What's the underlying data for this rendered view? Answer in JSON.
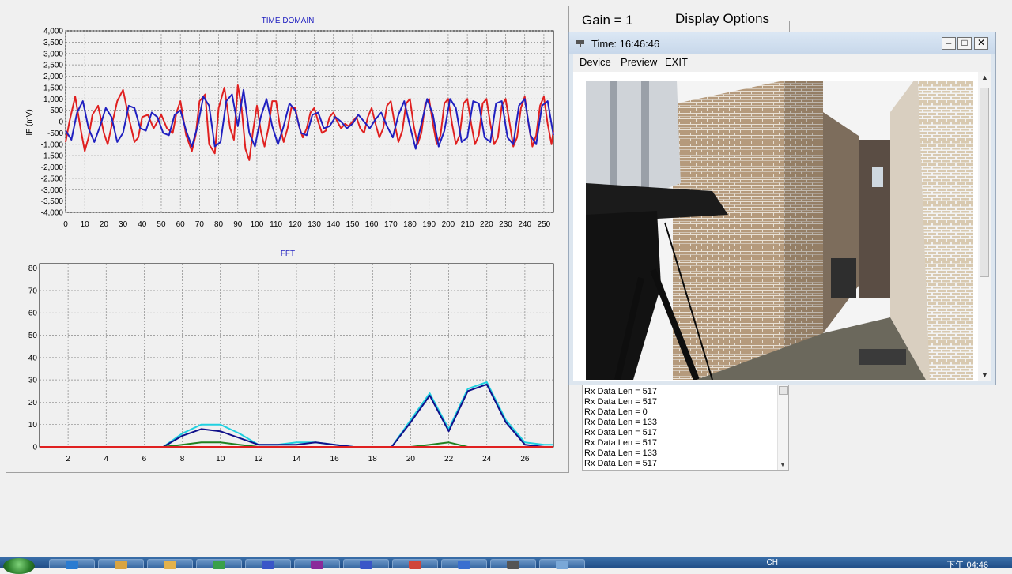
{
  "time_chart": {
    "title": "TIME DOMAIN",
    "ylabel": "IF (mV)",
    "y_ticks": [
      "4,000",
      "3,500",
      "3,000",
      "2,500",
      "2,000",
      "1,500",
      "1,000",
      "500",
      "0",
      "-500",
      "-1,000",
      "-1,500",
      "-2,000",
      "-2,500",
      "-3,000",
      "-3,500",
      "-4,000"
    ],
    "x_ticks": [
      "0",
      "10",
      "20",
      "30",
      "40",
      "50",
      "60",
      "70",
      "80",
      "90",
      "100",
      "110",
      "120",
      "130",
      "140",
      "150",
      "160",
      "170",
      "180",
      "190",
      "200",
      "210",
      "220",
      "230",
      "240",
      "250"
    ]
  },
  "fft_chart": {
    "title": "FFT",
    "y_ticks": [
      "80",
      "70",
      "60",
      "50",
      "40",
      "30",
      "20",
      "10",
      "0"
    ],
    "x_ticks": [
      "2",
      "4",
      "6",
      "8",
      "10",
      "12",
      "14",
      "16",
      "18",
      "20",
      "22",
      "24",
      "26"
    ]
  },
  "chart_data": [
    {
      "type": "line",
      "title": "TIME DOMAIN",
      "xlabel": "",
      "ylabel": "IF (mV)",
      "xlim": [
        0,
        255
      ],
      "ylim": [
        -4000,
        4000
      ],
      "grid": true,
      "series": [
        {
          "color": "#e02020",
          "x": [
            0,
            2,
            5,
            8,
            10,
            12,
            14,
            17,
            20,
            22,
            24,
            27,
            30,
            33,
            36,
            38,
            40,
            43,
            46,
            50,
            53,
            56,
            58,
            60,
            63,
            66,
            68,
            70,
            73,
            75,
            78,
            80,
            83,
            86,
            88,
            90,
            92,
            94,
            96,
            98,
            100,
            102,
            104,
            106,
            108,
            110,
            112,
            114,
            116,
            118,
            120,
            122,
            124,
            126,
            128,
            130,
            132,
            134,
            136,
            138,
            140,
            142,
            144,
            146,
            148,
            150,
            152,
            154,
            156,
            158,
            160,
            162,
            164,
            166,
            168,
            170,
            172,
            174,
            176,
            178,
            180,
            182,
            184,
            186,
            188,
            190,
            192,
            194,
            196,
            198,
            200,
            202,
            204,
            206,
            208,
            210,
            212,
            214,
            216,
            218,
            220,
            222,
            224,
            226,
            228,
            230,
            232,
            234,
            236,
            238,
            240,
            242,
            244,
            246,
            248,
            250,
            252,
            254,
            255
          ],
          "y": [
            -900,
            0,
            1100,
            -400,
            -1300,
            -700,
            300,
            700,
            -500,
            -1000,
            -200,
            900,
            1400,
            200,
            -900,
            -700,
            200,
            300,
            -300,
            300,
            -300,
            -500,
            400,
            900,
            -600,
            -1300,
            -600,
            900,
            1200,
            -1000,
            -1400,
            600,
            1500,
            -300,
            -800,
            1600,
            600,
            -1200,
            -1700,
            -400,
            700,
            -400,
            -1100,
            -300,
            900,
            900,
            -200,
            -900,
            -300,
            600,
            600,
            -200,
            -700,
            -300,
            400,
            600,
            0,
            -500,
            -400,
            200,
            400,
            0,
            -300,
            -100,
            -200,
            0,
            200,
            -300,
            -500,
            200,
            600,
            -100,
            -700,
            -300,
            700,
            900,
            -100,
            -900,
            -400,
            800,
            1000,
            -200,
            -1000,
            -500,
            800,
            1000,
            -100,
            -1000,
            -600,
            800,
            1000,
            -100,
            -1000,
            -600,
            800,
            1000,
            -100,
            -1000,
            -600,
            800,
            1000,
            -100,
            -1000,
            -700,
            700,
            1000,
            0,
            -1100,
            -700,
            600,
            1100,
            -100,
            -1100,
            -600,
            700,
            1100,
            -100,
            -1000,
            -400
          ]
        },
        {
          "color": "#2020c0",
          "x": [
            0,
            3,
            6,
            9,
            12,
            15,
            18,
            21,
            24,
            27,
            30,
            33,
            36,
            39,
            42,
            45,
            48,
            51,
            54,
            57,
            60,
            63,
            66,
            69,
            72,
            75,
            78,
            81,
            84,
            87,
            90,
            93,
            96,
            99,
            102,
            105,
            108,
            111,
            114,
            117,
            120,
            123,
            126,
            129,
            132,
            135,
            138,
            141,
            144,
            147,
            150,
            153,
            156,
            159,
            162,
            165,
            168,
            171,
            174,
            177,
            180,
            183,
            186,
            189,
            192,
            195,
            198,
            201,
            204,
            207,
            210,
            213,
            216,
            219,
            222,
            225,
            228,
            231,
            234,
            237,
            240,
            243,
            246,
            249,
            252,
            255
          ],
          "y": [
            -400,
            -800,
            400,
            900,
            -300,
            -900,
            -200,
            600,
            200,
            -900,
            -500,
            700,
            600,
            -300,
            -400,
            400,
            200,
            -500,
            -600,
            300,
            500,
            -400,
            -1100,
            -200,
            1100,
            700,
            -1100,
            -900,
            900,
            1200,
            -200,
            1400,
            -500,
            -1100,
            200,
            1000,
            -200,
            -1000,
            -200,
            800,
            500,
            -500,
            -600,
            300,
            400,
            -300,
            -200,
            200,
            0,
            -300,
            -100,
            300,
            0,
            -300,
            100,
            400,
            -200,
            -700,
            300,
            900,
            -200,
            -1200,
            -100,
            1000,
            300,
            -1100,
            -400,
            1000,
            600,
            -900,
            -700,
            900,
            800,
            -700,
            -900,
            800,
            900,
            -700,
            -1000,
            700,
            1000,
            -600,
            -1000,
            700,
            900,
            -600
          ]
        }
      ]
    },
    {
      "type": "line",
      "title": "FFT",
      "xlabel": "",
      "ylabel": "",
      "xlim": [
        0.5,
        27.5
      ],
      "ylim": [
        0,
        82
      ],
      "grid": true,
      "series": [
        {
          "color": "#20d0e0",
          "x": [
            0.5,
            7,
            8,
            9,
            10,
            11,
            12,
            13,
            14,
            15,
            16,
            17,
            19,
            20,
            21,
            22,
            23,
            24,
            25,
            26,
            27,
            27.5
          ],
          "y": [
            0,
            0,
            6,
            10,
            10,
            6,
            1,
            1,
            2,
            2,
            1,
            0,
            0,
            12,
            24,
            8,
            26,
            29,
            12,
            2,
            1,
            1
          ]
        },
        {
          "color": "#10108a",
          "x": [
            0.5,
            7,
            8,
            9,
            10,
            11,
            12,
            13,
            14,
            15,
            16,
            17,
            19,
            20,
            21,
            22,
            23,
            24,
            25,
            26,
            27,
            27.5
          ],
          "y": [
            0,
            0,
            5,
            8,
            7,
            4,
            1,
            1,
            1,
            2,
            1,
            0,
            0,
            11,
            23,
            7,
            25,
            28,
            11,
            1,
            0,
            0
          ]
        },
        {
          "color": "#208020",
          "x": [
            0.5,
            7,
            8,
            9,
            10,
            11,
            12,
            13,
            14,
            15,
            16,
            17,
            19,
            20,
            21,
            22,
            23,
            24,
            25,
            26,
            27,
            27.5
          ],
          "y": [
            0,
            0,
            1,
            2,
            2,
            1,
            0,
            0,
            0,
            0,
            0,
            0,
            0,
            0,
            1,
            2,
            0,
            0,
            0,
            0,
            0,
            0
          ]
        },
        {
          "color": "#e02020",
          "x": [
            0.5,
            27.5
          ],
          "y": [
            0,
            0
          ]
        }
      ]
    }
  ],
  "controls": {
    "gain_label": "Gain = 1",
    "display_options_label": "Display Options"
  },
  "log": {
    "lines": [
      "Rx Data Len = 517",
      "Rx Data Len = 517",
      "Rx Data Len = 0",
      "Rx Data Len = 133",
      "Rx Data Len = 517",
      "Rx Data Len = 517",
      "Rx Data Len = 133",
      "Rx Data Len = 517"
    ]
  },
  "preview_window": {
    "title": "Time: 16:46:46",
    "menu": [
      "Device",
      "Preview",
      "EXIT"
    ],
    "minimize": "–",
    "maximize": "□",
    "close": "✕"
  },
  "taskbar": {
    "clock": "下午 04:46",
    "ime": "CH",
    "apps": [
      "explorer",
      "folder",
      "excel",
      "cascade",
      "help",
      "network",
      "paint",
      "word",
      "media",
      "display",
      "cascade2"
    ]
  },
  "colors": {
    "series_red": "#e02020",
    "series_blue": "#2020c0",
    "series_cyan": "#20d0e0",
    "series_green": "#208020",
    "taskbar": "#1f4c85"
  }
}
